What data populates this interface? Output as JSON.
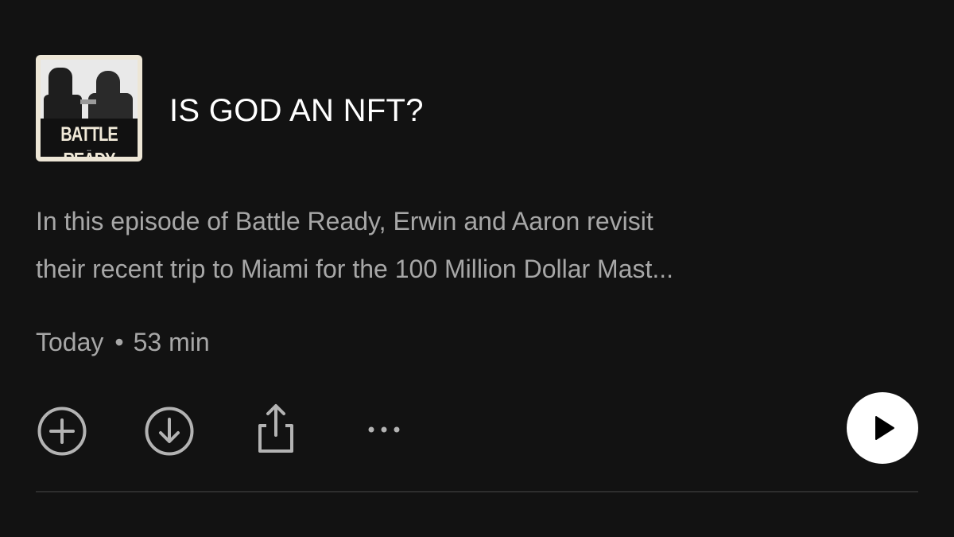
{
  "episode": {
    "cover": {
      "brand_text": "BATTLE READY",
      "sub_text": "•••"
    },
    "title": "IS GOD AN NFT?",
    "description_lines": [
      "In this episode of Battle Ready, Erwin and Aaron revisit",
      "their recent trip to Miami for the 100 Million Dollar Mast..."
    ],
    "meta": {
      "date": "Today",
      "separator": "•",
      "duration": "53 min"
    },
    "actions": {
      "add_icon": "plus-circle-icon",
      "download_icon": "download-circle-icon",
      "share_icon": "share-icon",
      "more_icon": "more-horizontal-icon",
      "play_icon": "play-icon"
    }
  },
  "colors": {
    "background": "#121212",
    "title": "#ffffff",
    "secondary_text": "#a7a7a7",
    "icon": "#b3b3b3",
    "play_button_bg": "#ffffff",
    "play_icon": "#000000",
    "divider": "#2e2e2e"
  }
}
